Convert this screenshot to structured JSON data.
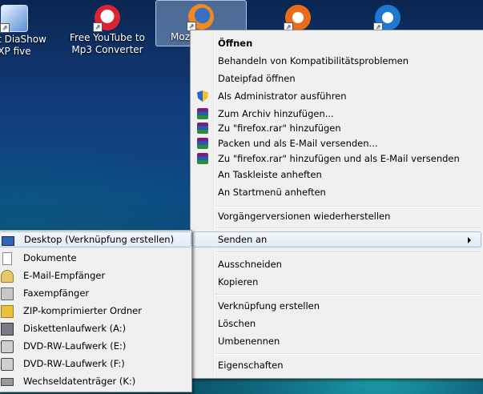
{
  "desktop": {
    "icons": [
      {
        "label_line1": "Soft DiaShow",
        "label_line2": "XP five",
        "icon": "diashow-app-icon"
      },
      {
        "label_line1": "Free YouTube to",
        "label_line2": "Mp3 Converter",
        "icon": "youtube-mp3-converter-icon"
      },
      {
        "label_line1": "Moz",
        "label_line2": "",
        "icon": "firefox-icon"
      },
      {
        "label_line1": "",
        "label_line2": "",
        "icon": "app-icon-9"
      },
      {
        "label_line1": "",
        "label_line2": "",
        "icon": "app-icon-blue"
      }
    ]
  },
  "context_menu": {
    "items": [
      {
        "label": "Öffnen",
        "bold": true
      },
      {
        "label": "Behandeln von Kompatibilitätsproblemen"
      },
      {
        "label": "Dateipfad öffnen"
      },
      {
        "label": "Als Administrator ausführen",
        "icon": "uac-shield-icon"
      },
      {
        "label": "Zum Archiv hinzufügen...",
        "icon": "winrar-icon"
      },
      {
        "label": "Zu \"firefox.rar\" hinzufügen",
        "icon": "winrar-icon"
      },
      {
        "label": "Packen und als E-Mail versenden...",
        "icon": "winrar-icon"
      },
      {
        "label": "Zu \"firefox.rar\" hinzufügen und als E-Mail versenden",
        "icon": "winrar-icon"
      },
      {
        "label": "An Taskleiste anheften"
      },
      {
        "label": "An Startmenü anheften"
      },
      {
        "label": "Vorgängerversionen wiederherstellen"
      },
      {
        "label": "Senden an",
        "submenu": true
      },
      {
        "label": "Ausschneiden"
      },
      {
        "label": "Kopieren"
      },
      {
        "label": "Verknüpfung erstellen"
      },
      {
        "label": "Löschen"
      },
      {
        "label": "Umbenennen"
      },
      {
        "label": "Eigenschaften"
      }
    ]
  },
  "send_to_menu": {
    "items": [
      {
        "label": "Desktop (Verknüpfung erstellen)",
        "icon": "desktop-icon"
      },
      {
        "label": "Dokumente",
        "icon": "documents-icon"
      },
      {
        "label": "E-Mail-Empfänger",
        "icon": "mail-recipient-icon"
      },
      {
        "label": "Faxempfänger",
        "icon": "fax-icon"
      },
      {
        "label": "ZIP-komprimierter Ordner",
        "icon": "zip-folder-icon"
      },
      {
        "label": "Diskettenlaufwerk (A:)",
        "icon": "floppy-drive-icon"
      },
      {
        "label": "DVD-RW-Laufwerk (E:)",
        "icon": "dvd-drive-icon"
      },
      {
        "label": "DVD-RW-Laufwerk (F:)",
        "icon": "dvd-drive-icon"
      },
      {
        "label": "Wechseldatenträger (K:)",
        "icon": "removable-drive-icon"
      }
    ]
  },
  "colors": {
    "menu_bg": "#f0f0f0",
    "menu_border": "#979797",
    "hover_border": "#a8c0e0",
    "desktop_bg": "#0d4a86"
  }
}
